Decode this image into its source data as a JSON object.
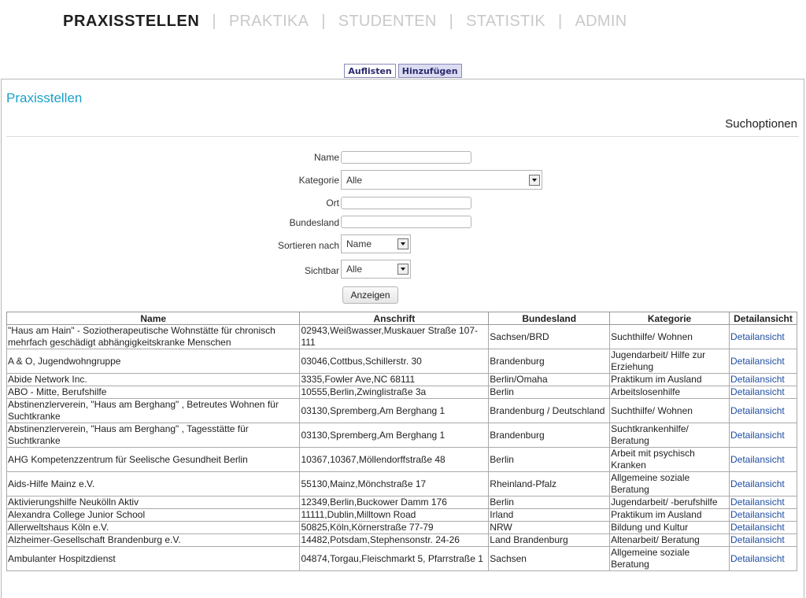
{
  "nav": {
    "items": [
      "PRAXISSTELLEN",
      "PRAKTIKA",
      "STUDENTEN",
      "STATISTIK",
      "ADMIN"
    ]
  },
  "tabs": [
    "Auflisten",
    "Hinzufügen"
  ],
  "page": {
    "title": "Praxisstellen",
    "search_heading": "Suchoptionen"
  },
  "form": {
    "name_label": "Name",
    "name_value": "",
    "kategorie_label": "Kategorie",
    "kategorie_value": "Alle",
    "ort_label": "Ort",
    "ort_value": "",
    "bundesland_label": "Bundesland",
    "bundesland_value": "",
    "sort_label": "Sortieren nach",
    "sort_value": "Name",
    "sichtbar_label": "Sichtbar",
    "sichtbar_value": "Alle",
    "submit_label": "Anzeigen"
  },
  "table": {
    "headers": [
      "Name",
      "Anschrift",
      "Bundesland",
      "Kategorie",
      "Detailansicht"
    ],
    "rows": [
      [
        "\"Haus am Hain\" - Soziotherapeutische Wohnstätte für chronisch mehrfach geschädigt abhängigkeitskranke Menschen",
        "02943,Weißwasser,Muskauer Straße 107-111",
        "Sachsen/BRD",
        "Suchthilfe/ Wohnen",
        "Detailansicht"
      ],
      [
        "A & O, Jugendwohngruppe",
        "03046,Cottbus,Schillerstr. 30",
        "Brandenburg",
        "Jugendarbeit/ Hilfe zur Erziehung",
        "Detailansicht"
      ],
      [
        "Abide Network Inc.",
        "3335,Fowler Ave,NC 68111",
        "Berlin/Omaha",
        "Praktikum im Ausland",
        "Detailansicht"
      ],
      [
        "ABO - Mitte, Berufshilfe",
        "10555,Berlin,Zwinglistraße 3a",
        "Berlin",
        "Arbeitslosenhilfe",
        "Detailansicht"
      ],
      [
        "Abstinenzlerverein, \"Haus am Berghang\" , Betreutes Wohnen für Suchtkranke",
        "03130,Spremberg,Am Berghang 1",
        "Brandenburg / Deutschland",
        "Suchthilfe/ Wohnen",
        "Detailansicht"
      ],
      [
        "Abstinenzlerverein, \"Haus am Berghang\" , Tagesstätte für Suchtkranke",
        "03130,Spremberg,Am Berghang 1",
        "Brandenburg",
        "Suchtkrankenhilfe/ Beratung",
        "Detailansicht"
      ],
      [
        "AHG Kompetenzzentrum für Seelische Gesundheit Berlin",
        "10367,10367,Möllendorffstraße 48",
        "Berlin",
        "Arbeit mit psychisch Kranken",
        "Detailansicht"
      ],
      [
        "Aids-Hilfe Mainz e.V.",
        "55130,Mainz,Mönchstraße 17",
        "Rheinland-Pfalz",
        "Allgemeine soziale Beratung",
        "Detailansicht"
      ],
      [
        "Aktivierungshilfe Neukölln Aktiv",
        "12349,Berlin,Buckower Damm 176",
        "Berlin",
        "Jugendarbeit/ -berufshilfe",
        "Detailansicht"
      ],
      [
        "Alexandra College Junior School",
        "11111,Dublin,Milltown Road",
        "Irland",
        "Praktikum im Ausland",
        "Detailansicht"
      ],
      [
        "Allerweltshaus Köln e.V.",
        "50825,Köln,Körnerstraße 77-79",
        "NRW",
        "Bildung und Kultur",
        "Detailansicht"
      ],
      [
        "Alzheimer-Gesellschaft Brandenburg e.V.",
        "14482,Potsdam,Stephensonstr. 24-26",
        "Land Brandenburg",
        "Altenarbeit/ Beratung",
        "Detailansicht"
      ],
      [
        "Ambulanter Hospitzdienst",
        "04874,Torgau,Fleischmarkt 5, Pfarrstraße 1",
        "Sachsen",
        "Allgemeine soziale Beratung",
        "Detailansicht"
      ]
    ]
  }
}
